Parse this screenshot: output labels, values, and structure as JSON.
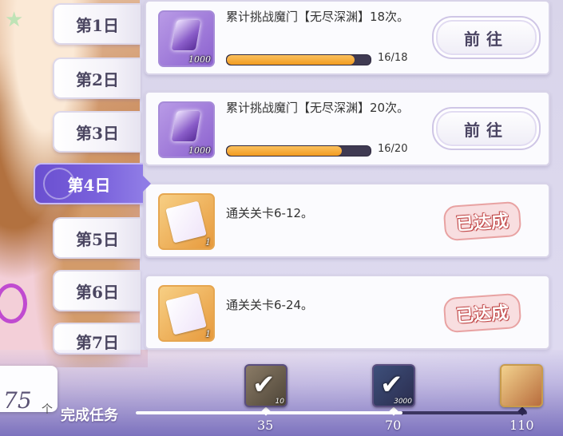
{
  "days": [
    {
      "label": "第1日",
      "active": false
    },
    {
      "label": "第2日",
      "active": false
    },
    {
      "label": "第3日",
      "active": false
    },
    {
      "label": "第4日",
      "active": true
    },
    {
      "label": "第5日",
      "active": false
    },
    {
      "label": "第6日",
      "active": false
    },
    {
      "label": "第7日",
      "active": false
    }
  ],
  "tasks": [
    {
      "desc": "累计挑战魔门【无尽深渊】18次。",
      "item_type": "gem",
      "item_qty": "1000",
      "progress_text": "16/18",
      "progress": 0.889,
      "status": "go",
      "button_label": "前往"
    },
    {
      "desc": "累计挑战魔门【无尽深渊】20次。",
      "item_type": "gem",
      "item_qty": "1000",
      "progress_text": "16/20",
      "progress": 0.8,
      "status": "go",
      "button_label": "前往"
    },
    {
      "desc": "通关关卡6-12。",
      "item_type": "ticket",
      "item_qty": "1",
      "status": "done",
      "stamp_label": "已达成"
    },
    {
      "desc": "通关关卡6-24。",
      "item_type": "ticket",
      "item_qty": "1",
      "status": "done",
      "stamp_label": "已达成"
    }
  ],
  "footer": {
    "score": "75",
    "unit": "个",
    "label": "完成任务",
    "progress": 0.682,
    "milestones": [
      {
        "value": "35",
        "reward": "check-reward",
        "qty": "10",
        "claimed": true
      },
      {
        "value": "70",
        "reward": "check-reward",
        "qty": "3000",
        "claimed": true
      },
      {
        "value": "110",
        "reward": "character-reward",
        "qty": "",
        "claimed": false
      }
    ]
  },
  "colors": {
    "accent": "#6a4fd0",
    "progress": "#f29b20",
    "stamp": "#e8a2a2"
  }
}
